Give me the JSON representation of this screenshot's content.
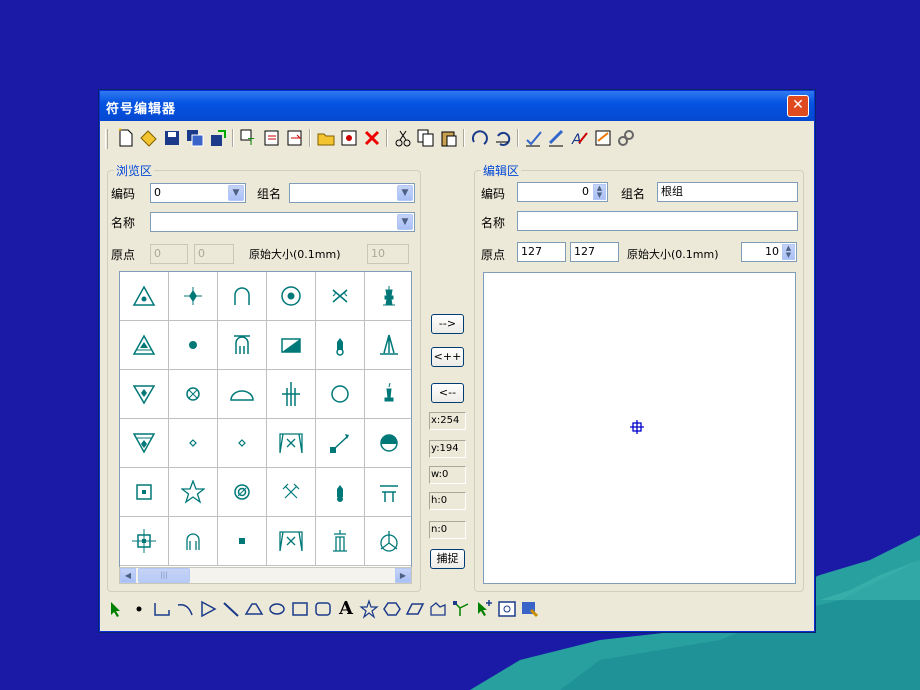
{
  "window": {
    "title": "符号编辑器",
    "close_label": "✕"
  },
  "toolbar": {
    "icons": [
      "new-icon",
      "open-icon",
      "save-icon",
      "save-as-icon",
      "export-icon",
      "text-copy-icon",
      "import-icon",
      "batch-import-icon",
      "folder-new-icon",
      "properties-icon",
      "delete-icon",
      "cut-icon",
      "copy-icon",
      "paste-icon",
      "rotate-icon",
      "undo-icon",
      "pen-icon",
      "pen-alt-icon",
      "edit-text-icon",
      "report-icon",
      "link-icon"
    ]
  },
  "browse": {
    "legend": "浏览区",
    "code_label": "编码",
    "code_value": "0",
    "group_label": "组名",
    "group_value": "",
    "name_label": "名称",
    "name_value": "",
    "origin_label": "原点",
    "origin_x": "0",
    "origin_y": "0",
    "size_label": "原始大小(0.1mm)",
    "size_value": "10",
    "scroll_left": "◀",
    "scroll_right": "▶",
    "scroll_thumb": "|||"
  },
  "middle": {
    "to_right": "-->",
    "append": "<++",
    "to_left": "<--",
    "x": "x:254",
    "y": "y:194",
    "w": "w:0",
    "h": "h:0",
    "n": "n:0",
    "snap": "捕捉"
  },
  "edit": {
    "legend": "编辑区",
    "code_label": "编码",
    "code_value": "0",
    "group_label": "组名",
    "group_value": "根组",
    "name_label": "名称",
    "name_value": "",
    "origin_label": "原点",
    "origin_x": "127",
    "origin_y": "127",
    "size_label": "原始大小(0.1mm)",
    "size_value": "10"
  },
  "drawing_tools": [
    "select-arrow-icon",
    "point-icon",
    "polyline-icon",
    "arc-icon",
    "polygon-icon",
    "line-icon",
    "half-circle-icon",
    "ellipse-icon",
    "rectangle-icon",
    "rounded-rect-icon",
    "text-icon",
    "star-icon",
    "hexagon-icon",
    "parallelogram-icon",
    "bezier-icon",
    "node-edit-icon",
    "node-select-icon",
    "image-icon",
    "fill-icon"
  ],
  "text_tool_label": "A",
  "colors": {
    "accent": "#0054e3",
    "symbol": "#007878",
    "desktop": "#1a1aa6"
  }
}
